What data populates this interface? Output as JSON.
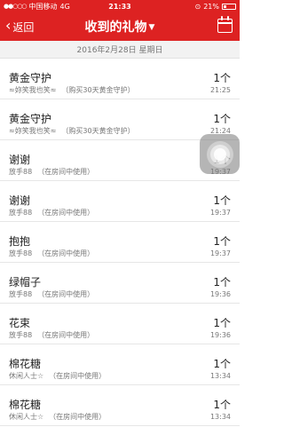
{
  "status_bar": {
    "carrier": "中国移动",
    "network": "4G",
    "time": "21:33",
    "battery": "21%"
  },
  "nav": {
    "back_label": "返回",
    "title": "收到的礼物",
    "calendar_icon": "calendar-icon"
  },
  "date_header": "2016年2月28日 星期日",
  "gifts": [
    {
      "name": "黄金守护",
      "sender": "≈妳笑我也笑≈",
      "note": "（购买30天黄金守护）",
      "count": "1个",
      "time": "21:25"
    },
    {
      "name": "黄金守护",
      "sender": "≈妳笑我也笑≈",
      "note": "（购买30天黄金守护）",
      "count": "1个",
      "time": "21:24"
    },
    {
      "name": "谢谢",
      "sender": "放手88",
      "note": "（在房间中使用）",
      "count": "1个",
      "time": "19:37"
    },
    {
      "name": "谢谢",
      "sender": "放手88",
      "note": "（在房间中使用）",
      "count": "1个",
      "time": "19:37"
    },
    {
      "name": "抱抱",
      "sender": "放手88",
      "note": "（在房间中使用）",
      "count": "1个",
      "time": "19:37"
    },
    {
      "name": "绿帽子",
      "sender": "放手88",
      "note": "（在房间中使用）",
      "count": "1个",
      "time": "19:36"
    },
    {
      "name": "花束",
      "sender": "放手88",
      "note": "（在房间中使用）",
      "count": "1个",
      "time": "19:36"
    },
    {
      "name": "棉花糖",
      "sender": "休闲人士☆",
      "note": "（在房间中使用）",
      "count": "1个",
      "time": "13:34"
    },
    {
      "name": "棉花糖",
      "sender": "休闲人士☆",
      "note": "（在房间中使用）",
      "count": "1个",
      "time": "13:34"
    }
  ],
  "colors": {
    "accent": "#dd2222",
    "date_bg": "#f2f2f2"
  }
}
